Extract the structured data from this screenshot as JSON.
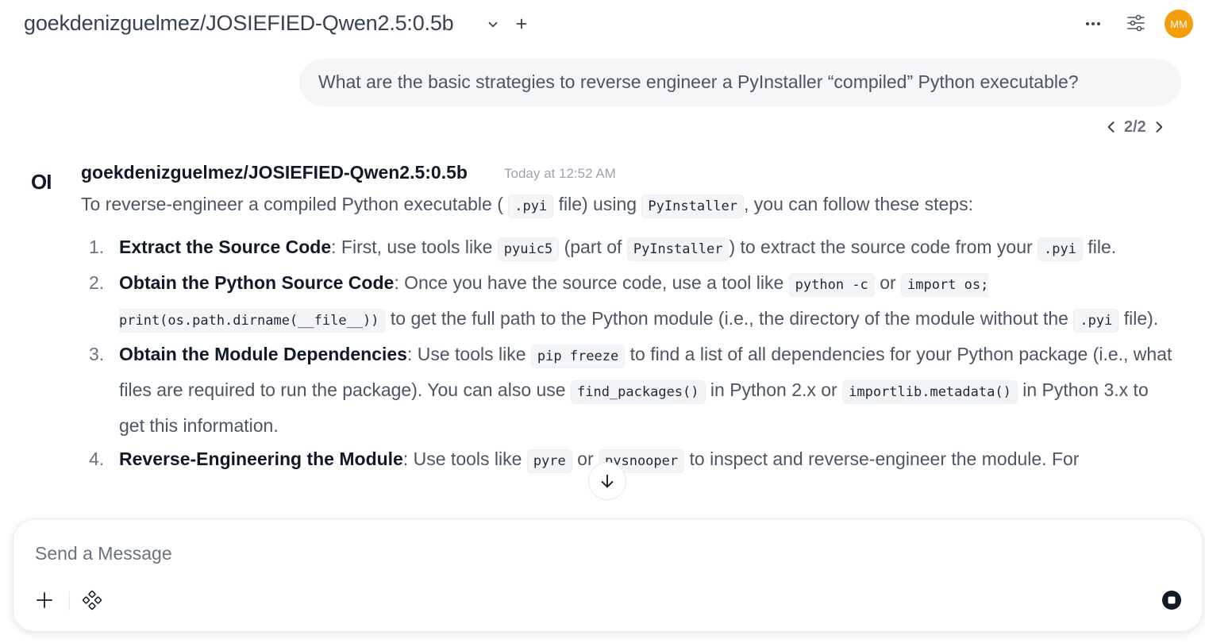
{
  "header": {
    "model_name": "goekdenizguelmez/JOSIEFIED-Qwen2.5:0.5b",
    "avatar_initials": "MM",
    "avatar_color": "#f59e0b"
  },
  "user_message": {
    "text": "What are the basic strategies to reverse engineer a PyInstaller “compiled” Python executable?",
    "pager": "2/2"
  },
  "assistant": {
    "logo": "OI",
    "name": "goekdenizguelmez/JOSIEFIED-Qwen2.5:0.5b",
    "timestamp": "Today at 12:52 AM",
    "intro": {
      "t1": "To reverse-engineer a compiled Python executable (",
      "c1": ".pyi",
      "t2": "file) using",
      "c2": "PyInstaller",
      "t3": ", you can follow these steps:"
    },
    "items": [
      {
        "num": "1.",
        "title": "Extract the Source Code",
        "t1": ": First, use tools like",
        "c1": "pyuic5",
        "t2": "(part of",
        "c2": "PyInstaller",
        "t3": ") to extract the source code from your",
        "c3": ".pyi",
        "t4": "file."
      },
      {
        "num": "2.",
        "title": "Obtain the Python Source Code",
        "t1": ": Once you have the source code, use a tool like",
        "c1": "python -c",
        "t2": "or",
        "c2": "import os; print(os.path.dirname(__file__))",
        "t3": "to get the full path to the Python module (i.e., the directory of the module without the",
        "c3": ".pyi",
        "t4": "file)."
      },
      {
        "num": "3.",
        "title": "Obtain the Module Dependencies",
        "t1": ": Use tools like",
        "c1": "pip freeze",
        "t2": "to find a list of all dependencies for your Python package (i.e., what files are required to run the package). You can also use",
        "c2": "find_packages()",
        "t3": "in Python 2.x or",
        "c3": "importlib.metadata()",
        "t4": "in Python 3.x to get this information."
      },
      {
        "num": "4.",
        "title": "Reverse-Engineering the Module",
        "t1": ": Use tools like",
        "c1": "pyre",
        "t2": "or",
        "c2": "pysnooper",
        "t3": "to inspect and reverse-engineer the module. For"
      }
    ]
  },
  "composer": {
    "placeholder": "Send a Message"
  }
}
